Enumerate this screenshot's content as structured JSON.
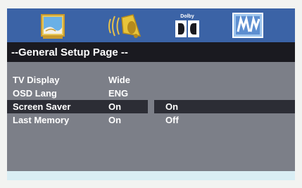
{
  "icon_bar": {
    "icons": [
      "picture-setup-icon",
      "audio-setup-icon",
      "dolby-digital-icon",
      "general-setup-icon"
    ],
    "dolby_text": "Dolby",
    "accent_color": "#3b63a6"
  },
  "page": {
    "title": "--General Setup Page --"
  },
  "menu": {
    "items": [
      {
        "label": "TV Display",
        "value": "Wide"
      },
      {
        "label": "OSD Lang",
        "value": "ENG"
      },
      {
        "label": "Screen Saver",
        "value": "On"
      },
      {
        "label": "Last Memory",
        "value": "On"
      }
    ],
    "selected_index": 2
  },
  "submenu": {
    "options": [
      "On",
      "Off"
    ],
    "selected_index": 0
  }
}
